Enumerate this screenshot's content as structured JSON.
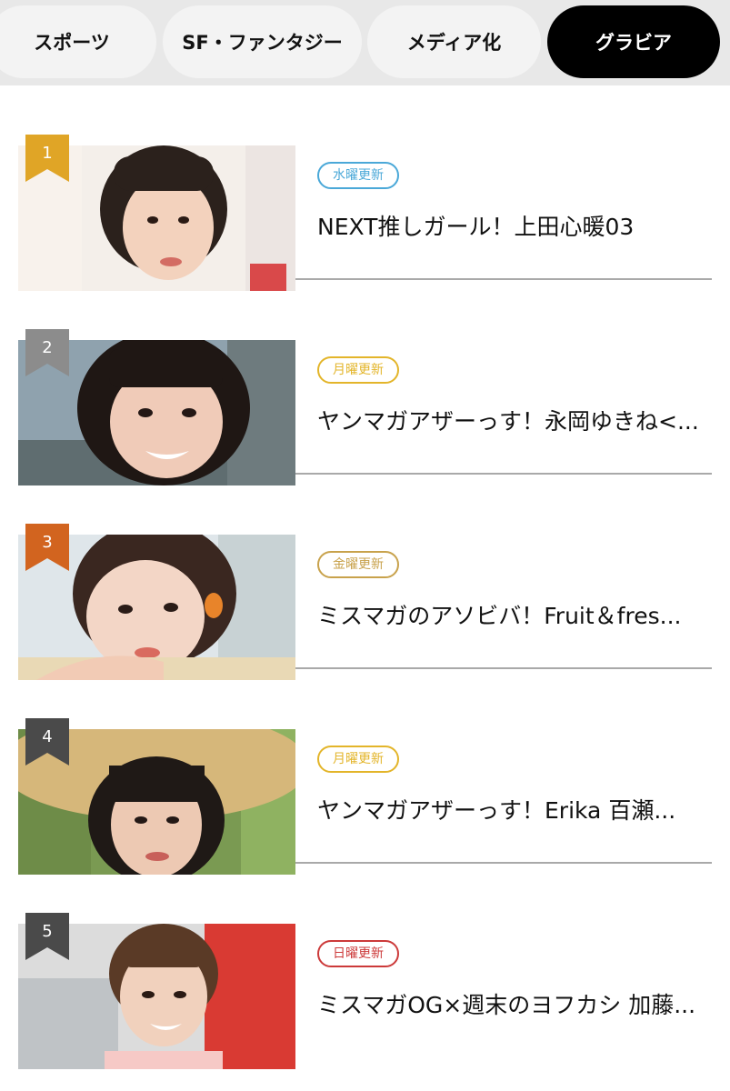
{
  "tabs": [
    {
      "label": "スポーツ",
      "active": false
    },
    {
      "label": "SF・ファンタジー",
      "active": false
    },
    {
      "label": "メディア化",
      "active": false
    },
    {
      "label": "グラビア",
      "active": true
    }
  ],
  "ranking": [
    {
      "rank": "1",
      "badge": "水曜更新",
      "badge_color": "#4aa8d8",
      "title": "NEXT推しガール！上田心暖03",
      "rank_color": "#e0a526"
    },
    {
      "rank": "2",
      "badge": "月曜更新",
      "badge_color": "#e3b52a",
      "title": "ヤンマガアザーっす！永岡ゆきね<...",
      "rank_color": "#8c8c8c"
    },
    {
      "rank": "3",
      "badge": "金曜更新",
      "badge_color": "#c8a24c",
      "title": "ミスマガのアソビバ！Fruit＆fres...",
      "rank_color": "#d2641f"
    },
    {
      "rank": "4",
      "badge": "月曜更新",
      "badge_color": "#e3b52a",
      "title": "ヤンマガアザーっす！Erika 百瀬...",
      "rank_color": "#4a4a4a"
    },
    {
      "rank": "5",
      "badge": "日曜更新",
      "badge_color": "#cc3a3a",
      "title": "ミスマガOG×週末のヨフカシ 加藤...",
      "rank_color": "#4a4a4a"
    }
  ]
}
